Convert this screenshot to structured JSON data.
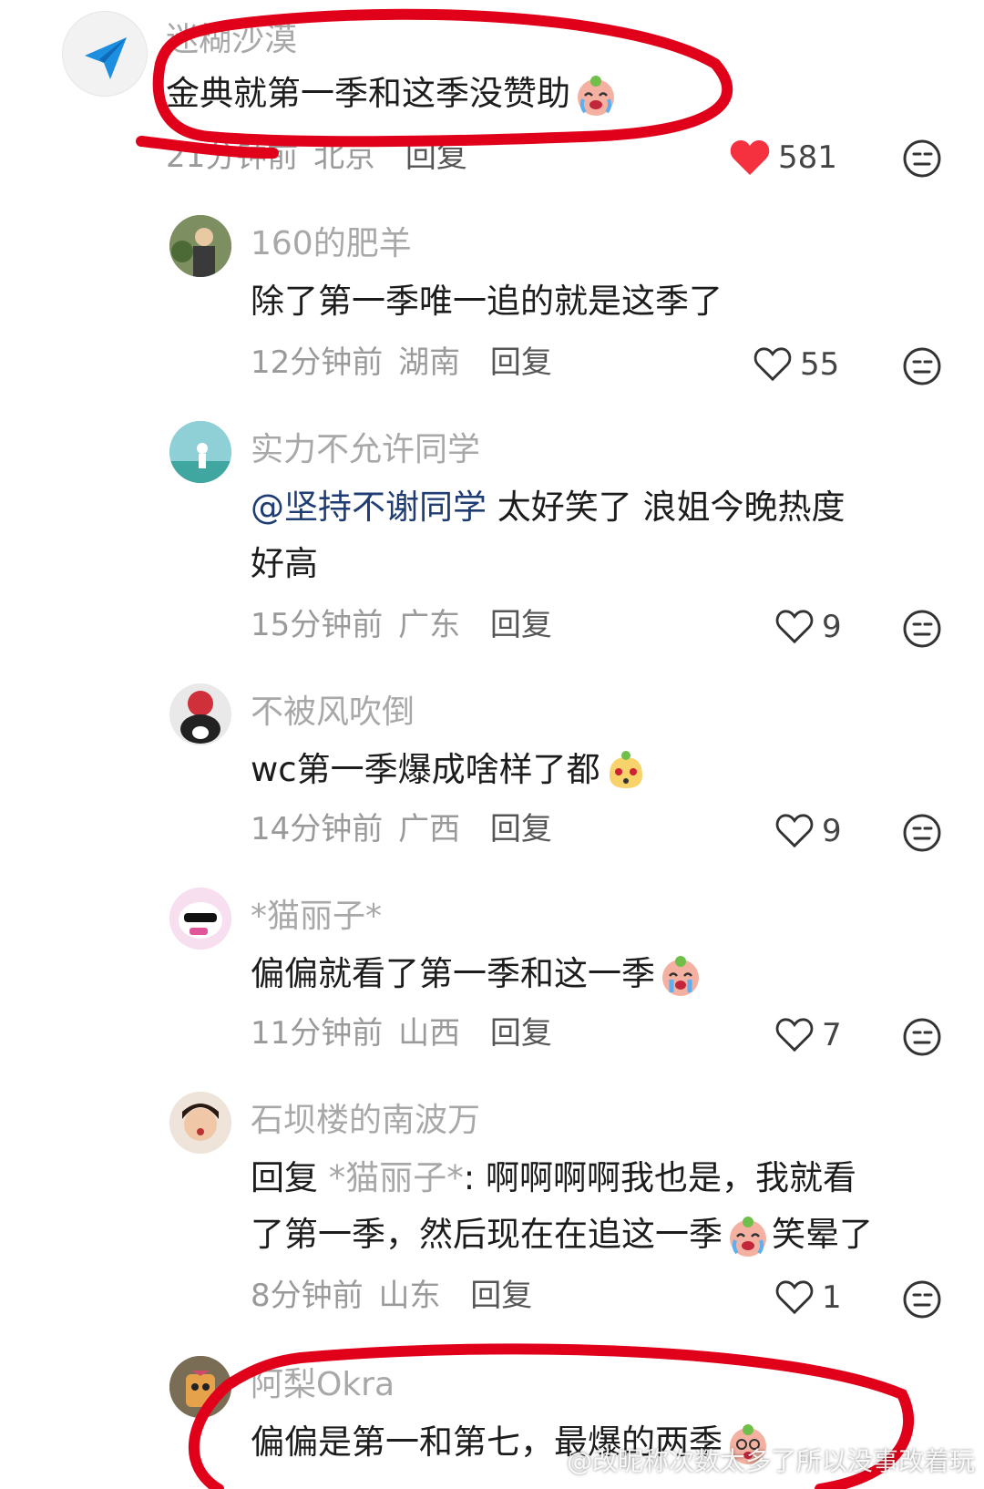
{
  "comments": [
    {
      "username": "迷糊沙漠",
      "text": "金典就第一季和这季没赞助",
      "time": "21分钟前",
      "location": "北京",
      "reply_label": "回复",
      "likes": "581",
      "liked": true
    },
    {
      "username": "160的肥羊",
      "text": "除了第一季唯一追的就是这季了",
      "time": "12分钟前",
      "location": "湖南",
      "reply_label": "回复",
      "likes": "55"
    },
    {
      "username": "实力不允许同学",
      "mention": "@坚持不谢同学",
      "text_line1": " 太好笑了  浪姐今晚热度",
      "text_line2": "好高",
      "time": "15分钟前",
      "location": "广东",
      "reply_label": "回复",
      "likes": "9"
    },
    {
      "username": "不被风吹倒",
      "text": "wc第一季爆成啥样了都",
      "time": "14分钟前",
      "location": "广西",
      "reply_label": "回复",
      "likes": "9"
    },
    {
      "username": "*猫丽子*",
      "text": "偏偏就看了第一季和这一季",
      "time": "11分钟前",
      "location": "山西",
      "reply_label": "回复",
      "likes": "7"
    },
    {
      "username": "石坝楼的南波万",
      "reply_prefix": "回复 ",
      "reply_to": "*猫丽子*",
      "text_line1": ": 啊啊啊啊我也是，我就看",
      "text_line2a": "了第一季，然后现在在追这一季",
      "text_line2b": "笑晕了",
      "time": "8分钟前",
      "location": "山东",
      "reply_label": "回复",
      "likes": "1"
    },
    {
      "username": "阿梨Okra",
      "text": "偏偏是第一和第七，最爆的两季"
    }
  ],
  "watermark": "@改昵称次数太多了所以没事改着玩",
  "colors": {
    "like_red": "#f5303f",
    "annotation_red": "#e0001a",
    "mention_blue": "#1f3d73"
  },
  "icons": {
    "like": "heart-icon",
    "dislike": "neutral-face-icon"
  }
}
